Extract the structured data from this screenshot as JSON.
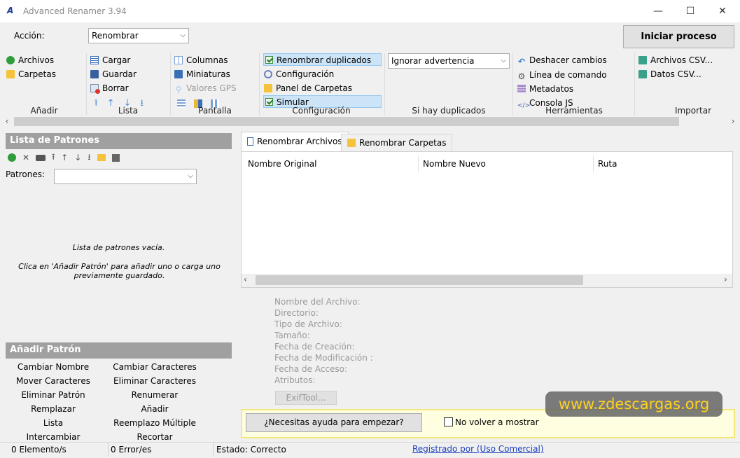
{
  "window": {
    "title": "Advanced Renamer 3.94",
    "minimize": "—",
    "maximize": "☐",
    "close": "✕"
  },
  "top": {
    "accion_label": "Acción:",
    "accion_value": "Renombrar",
    "start_button": "Iniciar proceso"
  },
  "ribbon": {
    "anadir": {
      "items": [
        "Archivos",
        "Carpetas"
      ],
      "label": "Añadir"
    },
    "lista": {
      "items": [
        "Cargar",
        "Guardar",
        "Borrar"
      ],
      "label": "Lista"
    },
    "pantalla": {
      "items": [
        "Columnas",
        "Miniaturas",
        "Valores GPS"
      ],
      "label": "Pantalla"
    },
    "configuracion": {
      "items": [
        "Renombrar duplicados",
        "Configuración",
        "Panel de Carpetas",
        "Simular"
      ],
      "label": "Configuración"
    },
    "duplicados": {
      "value": "Ignorar advertencia",
      "label": "Si hay duplicados"
    },
    "herramientas": {
      "items": [
        "Deshacer cambios",
        "Línea de comando",
        "Metadatos",
        "Consola JS"
      ],
      "label": "Herramientas"
    },
    "importar": {
      "items": [
        "Archivos CSV...",
        "Datos CSV..."
      ],
      "label": "Importar"
    }
  },
  "patterns_panel": {
    "title": "Lista de Patrones",
    "patrones_label": "Patrones:",
    "empty_title": "Lista de patrones vacía.",
    "empty_hint": "Clica en 'Añadir Patrón' para añadir uno o carga uno previamente guardado."
  },
  "add_pattern": {
    "title": "Añadir Patrón",
    "left": [
      "Cambiar Nombre",
      "Mover Caracteres",
      "Eliminar Patrón",
      "Remplazar",
      "Lista",
      "Intercambiar"
    ],
    "right": [
      "Cambiar Caracteres",
      "Eliminar Caracteres",
      "Renumerar",
      "Añadir",
      "Reemplazo Múltiple",
      "Recortar"
    ]
  },
  "tabs": [
    "Renombrar Archivos",
    "Renombrar Carpetas"
  ],
  "columns": [
    "Nombre Original",
    "Nombre Nuevo",
    "Ruta"
  ],
  "file_info": {
    "fields": [
      "Nombre del Archivo:",
      "Directorio:",
      "Tipo de Archivo:",
      "Tamaño:",
      "Fecha de Creación:",
      "Fecha de Modificación :",
      "Fecha de Acceso:",
      "Atributos:"
    ],
    "exif_button": "ExifTool..."
  },
  "help_bar": {
    "button": "¿Necesitas ayuda para empezar?",
    "checkbox_label": "No volver a mostrar"
  },
  "watermark": "www.zdescargas.org",
  "statusbar": {
    "elements": "0 Elemento/s",
    "errors": "0 Error/es",
    "state": "Estado: Correcto",
    "registered": "Registrado por  (Uso Comercial)"
  }
}
